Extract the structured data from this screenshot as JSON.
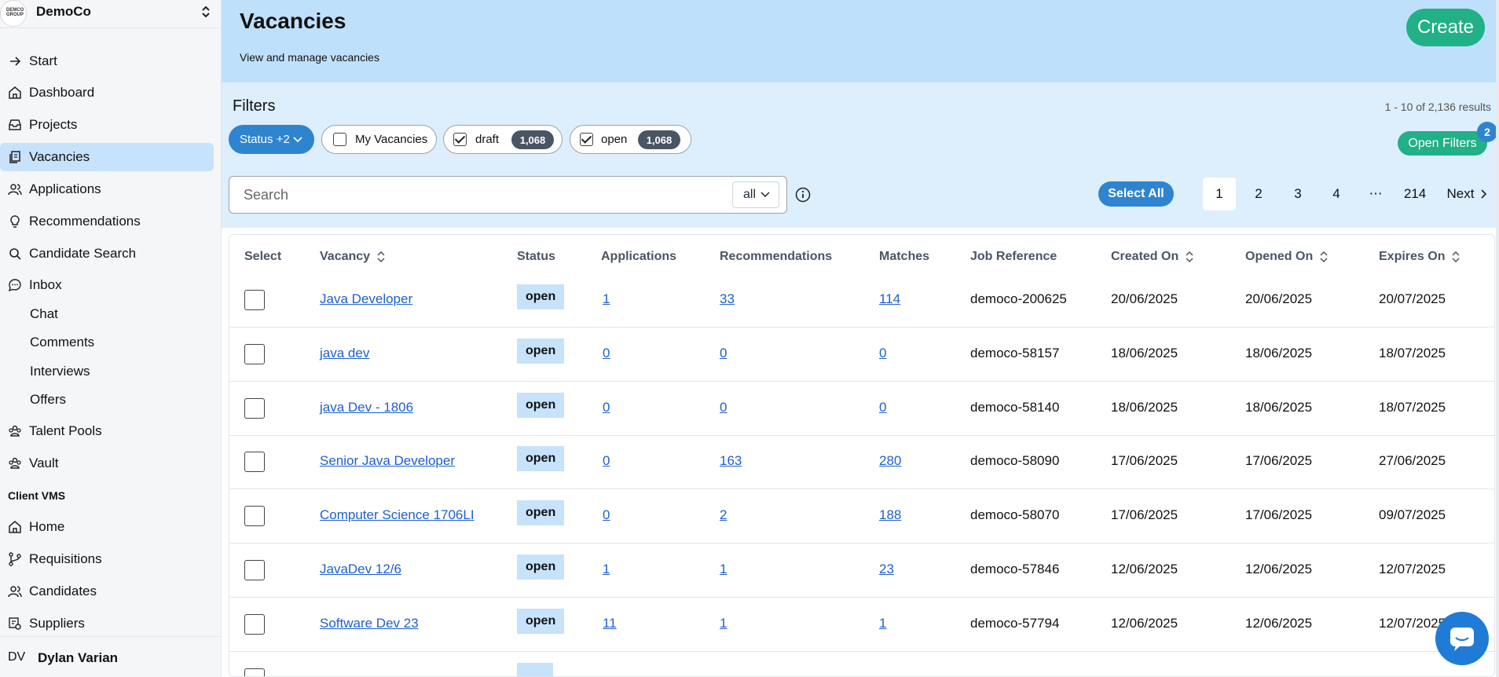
{
  "org": {
    "name": "DemoCo",
    "logo_text": "DEMCO GROUP"
  },
  "sidebar": {
    "items": [
      {
        "label": "Start",
        "icon": "arrow-right-icon"
      },
      {
        "label": "Dashboard",
        "icon": "home-icon"
      },
      {
        "label": "Projects",
        "icon": "inbox-tray-icon"
      },
      {
        "label": "Vacancies",
        "icon": "documents-icon",
        "active": true
      },
      {
        "label": "Applications",
        "icon": "users-icon"
      },
      {
        "label": "Recommendations",
        "icon": "lightbulb-icon"
      },
      {
        "label": "Candidate Search",
        "icon": "search-icon"
      },
      {
        "label": "Inbox",
        "icon": "chat-bubble-icon"
      }
    ],
    "inbox_sub": [
      "Chat",
      "Comments",
      "Interviews",
      "Offers"
    ],
    "items2": [
      {
        "label": "Talent Pools",
        "icon": "group-icon"
      },
      {
        "label": "Vault",
        "icon": "group-icon"
      }
    ],
    "section_label": "Client VMS",
    "items3": [
      {
        "label": "Home",
        "icon": "home-icon"
      },
      {
        "label": "Requisitions",
        "icon": "branch-icon"
      },
      {
        "label": "Candidates",
        "icon": "users-icon"
      },
      {
        "label": "Suppliers",
        "icon": "supplier-icon"
      }
    ],
    "user": {
      "initials": "DV",
      "name": "Dylan Varian"
    }
  },
  "header": {
    "title": "Vacancies",
    "subtitle": "View and manage vacancies",
    "create_label": "Create"
  },
  "filters": {
    "title": "Filters",
    "results": "1 - 10 of 2,136 results",
    "status_chip": "Status +2",
    "my_vacancies": "My Vacancies",
    "draft_label": "draft",
    "draft_count": "1,068",
    "open_label": "open",
    "open_count": "1,068",
    "open_filters_label": "Open Filters",
    "open_filters_badge": "2",
    "search_placeholder": "Search",
    "search_scope": "all",
    "select_all": "Select All",
    "pages": [
      "1",
      "2",
      "3",
      "4",
      "⋯",
      "214"
    ],
    "next": "Next"
  },
  "table": {
    "headers": {
      "select": "Select",
      "vacancy": "Vacancy",
      "status": "Status",
      "applications": "Applications",
      "recommendations": "Recommendations",
      "matches": "Matches",
      "job_reference": "Job Reference",
      "created_on": "Created On",
      "opened_on": "Opened On",
      "expires_on": "Expires On"
    },
    "rows": [
      {
        "vacancy": "Java Developer",
        "status": "open",
        "applications": "1",
        "recommendations": "33",
        "matches": "114",
        "ref": "democo-200625",
        "created": "20/06/2025",
        "opened": "20/06/2025",
        "expires": "20/07/2025"
      },
      {
        "vacancy": "java dev",
        "status": "open",
        "applications": "0",
        "recommendations": "0",
        "matches": "0",
        "ref": "democo-58157",
        "created": "18/06/2025",
        "opened": "18/06/2025",
        "expires": "18/07/2025"
      },
      {
        "vacancy": "java Dev - 1806",
        "status": "open",
        "applications": "0",
        "recommendations": "0",
        "matches": "0",
        "ref": "democo-58140",
        "created": "18/06/2025",
        "opened": "18/06/2025",
        "expires": "18/07/2025"
      },
      {
        "vacancy": "Senior Java Developer",
        "status": "open",
        "applications": "0",
        "recommendations": "163",
        "matches": "280",
        "ref": "democo-58090",
        "created": "17/06/2025",
        "opened": "17/06/2025",
        "expires": "27/06/2025"
      },
      {
        "vacancy": "Computer Science 1706LI",
        "status": "open",
        "applications": "0",
        "recommendations": "2",
        "matches": "188",
        "ref": "democo-58070",
        "created": "17/06/2025",
        "opened": "17/06/2025",
        "expires": "09/07/2025"
      },
      {
        "vacancy": "JavaDev 12/6",
        "status": "open",
        "applications": "1",
        "recommendations": "1",
        "matches": "23",
        "ref": "democo-57846",
        "created": "12/06/2025",
        "opened": "12/06/2025",
        "expires": "12/07/2025"
      },
      {
        "vacancy": "Software Dev 23",
        "status": "open",
        "applications": "11",
        "recommendations": "1",
        "matches": "1",
        "ref": "democo-57794",
        "created": "12/06/2025",
        "opened": "12/06/2025",
        "expires": "12/07/2025"
      }
    ]
  }
}
